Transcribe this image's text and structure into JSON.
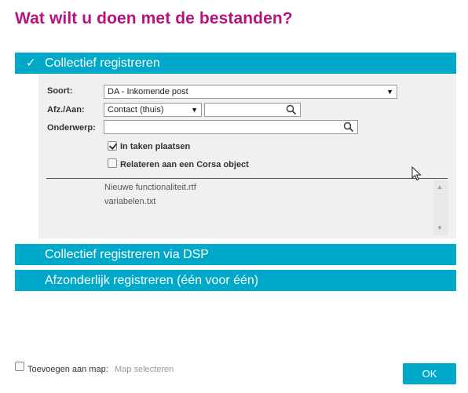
{
  "title": "Wat wilt u doen met de bestanden?",
  "sections": [
    {
      "label": "Collectief registreren",
      "expanded": true
    },
    {
      "label": "Collectief registreren via DSP",
      "expanded": false
    },
    {
      "label": "Afzonderlijk registreren (één voor één)",
      "expanded": false
    }
  ],
  "form": {
    "soort_label": "Soort:",
    "soort_value": "DA - Inkomende post",
    "afzaan_label": "Afz./Aan:",
    "afzaan_value": "Contact (thuis)",
    "afzaan_search": "",
    "onderwerp_label": "Onderwerp:",
    "onderwerp_value": "",
    "taken_label": "In taken plaatsen",
    "taken_checked": true,
    "relateren_label": "Relateren aan een Corsa object",
    "relateren_checked": false
  },
  "files": [
    "Nieuwe functionaliteit.rtf",
    "variabelen.txt"
  ],
  "footer": {
    "add_label": "Toevoegen aan map:",
    "map_link": "Map selecteren",
    "ok_label": "OK"
  },
  "colors": {
    "accent": "#00a9c9",
    "title": "#b5137e",
    "panel": "#f0f0f0"
  }
}
